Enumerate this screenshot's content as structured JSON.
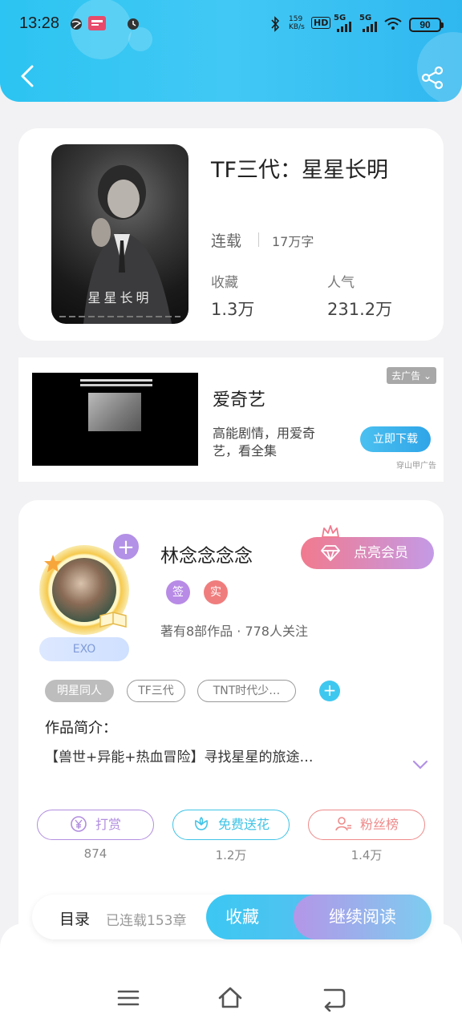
{
  "statusbar": {
    "time": "13:28",
    "network_speed": "159\nKB/s",
    "battery": "90",
    "signal_1": "5G",
    "signal_2": "5G",
    "hd": "HD"
  },
  "book": {
    "title": "TF三代：星星长明",
    "cover_title": "星星长明",
    "status": "连载",
    "word_count": "17万字",
    "favorites_label": "收藏",
    "favorites_value": "1.3万",
    "popularity_label": "人气",
    "popularity_value": "231.2万"
  },
  "ad": {
    "brand": "爱奇艺",
    "description": "高能剧情，用爱奇艺，看全集",
    "close_label": "去广告",
    "download_label": "立即下载",
    "source": "穿山甲广告"
  },
  "author": {
    "name": "林念念念念",
    "vip_label": "点亮会员",
    "badge_sign": "签",
    "badge_real": "实",
    "meta": "著有8部作品 · 778人关注",
    "fan_tag": "EXO",
    "plus": "+"
  },
  "tags": [
    {
      "label": "明星同人"
    },
    {
      "label": "TF三代"
    },
    {
      "label": "TNT时代少…"
    }
  ],
  "tag_add": "+",
  "intro": {
    "title": "作品简介：",
    "text": "【兽世+异能+热血冒险】寻找星星的旅途…"
  },
  "actions": [
    {
      "label": "打赏",
      "count": "874",
      "color": "#b28ee0"
    },
    {
      "label": "免费送花",
      "count": "1.2万",
      "color": "#3fc3e6"
    },
    {
      "label": "粉丝榜",
      "count": "1.4万",
      "color": "#ef8a8a"
    }
  ],
  "bottom": {
    "toc": "目录",
    "chapters": "已连载153章",
    "collect": "收藏",
    "read": "继续阅读"
  },
  "colors": {
    "header": "#2cc4f2",
    "accent_blue": "#3ec8f0",
    "accent_purple": "#b291e6",
    "vip_pink": "#f17a8e"
  }
}
